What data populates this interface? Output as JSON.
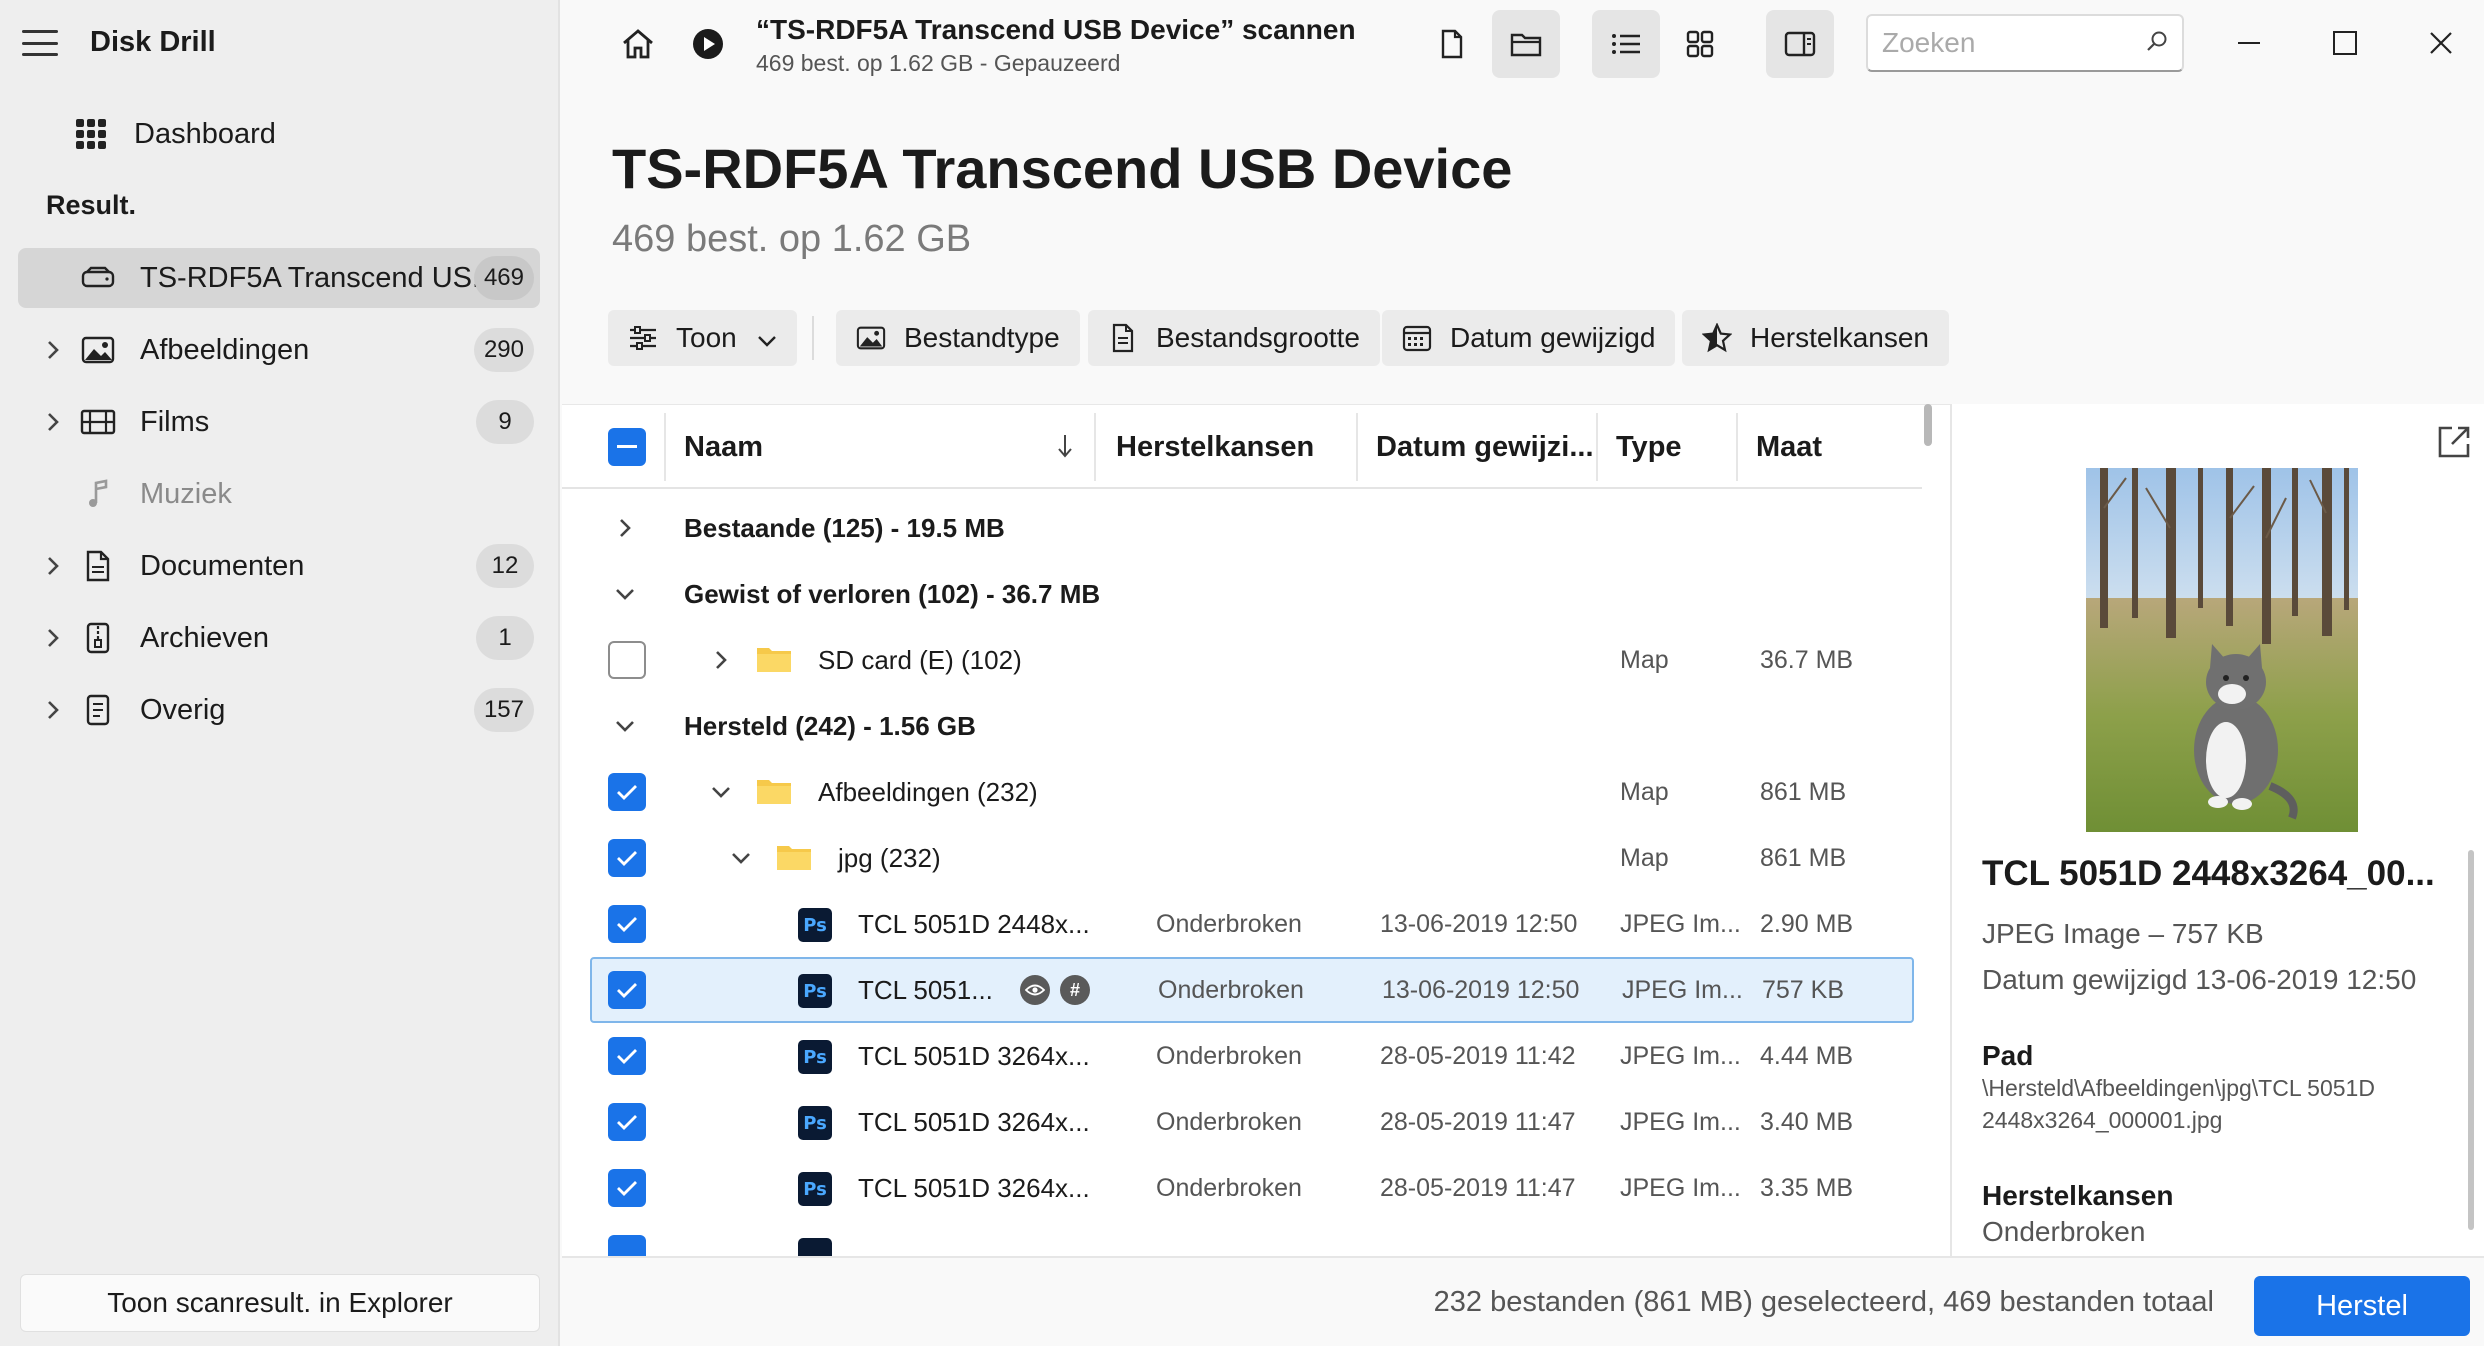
{
  "app": {
    "title": "Disk Drill"
  },
  "sidebar": {
    "dashboard_label": "Dashboard",
    "section_label": "Result.",
    "items": [
      {
        "label": "TS-RDF5A Transcend US...",
        "count": "469",
        "icon": "drive-icon"
      },
      {
        "label": "Afbeeldingen",
        "count": "290",
        "icon": "image-icon"
      },
      {
        "label": "Films",
        "count": "9",
        "icon": "film-icon"
      },
      {
        "label": "Muziek",
        "count": "",
        "icon": "music-note-icon"
      },
      {
        "label": "Documenten",
        "count": "12",
        "icon": "document-icon"
      },
      {
        "label": "Archieven",
        "count": "1",
        "icon": "archive-icon"
      },
      {
        "label": "Overig",
        "count": "157",
        "icon": "other-file-icon"
      }
    ],
    "explorer_button": "Toon scanresult. in Explorer"
  },
  "topbar": {
    "scan_title": "“TS-RDF5A Transcend USB Device” scannen",
    "scan_subtitle": "469 best. op 1.62 GB - Gepauzeerd",
    "search_placeholder": "Zoeken"
  },
  "heading": {
    "title": "TS-RDF5A Transcend USB Device",
    "subtitle": "469 best. op 1.62 GB"
  },
  "filters": {
    "show": "Toon",
    "filetype": "Bestandtype",
    "filesize": "Bestandsgrootte",
    "date_modified": "Datum gewijzigd",
    "recovery_chances": "Herstelkansen"
  },
  "table": {
    "columns": {
      "name": "Naam",
      "chances": "Herstelkansen",
      "date": "Datum gewijzi...",
      "type": "Type",
      "size": "Maat"
    },
    "groups": {
      "existing": "Bestaande (125) - 19.5 MB",
      "deleted": "Gewist of verloren (102) - 36.7 MB",
      "recovered": "Hersteld (242) - 1.56 GB"
    },
    "folders": [
      {
        "name": "SD card (E) (102)",
        "type": "Map",
        "size": "36.7 MB"
      },
      {
        "name": "Afbeeldingen (232)",
        "type": "Map",
        "size": "861 MB"
      },
      {
        "name": "jpg (232)",
        "type": "Map",
        "size": "861 MB"
      }
    ],
    "files": [
      {
        "name": "TCL 5051D 2448x...",
        "chances": "Onderbroken",
        "date": "13-06-2019 12:50",
        "type": "JPEG Im...",
        "size": "2.90 MB"
      },
      {
        "name": "TCL 5051...",
        "chances": "Onderbroken",
        "date": "13-06-2019 12:50",
        "type": "JPEG Im...",
        "size": "757 KB"
      },
      {
        "name": "TCL 5051D 3264x...",
        "chances": "Onderbroken",
        "date": "28-05-2019 11:42",
        "type": "JPEG Im...",
        "size": "4.44 MB"
      },
      {
        "name": "TCL 5051D 3264x...",
        "chances": "Onderbroken",
        "date": "28-05-2019 11:47",
        "type": "JPEG Im...",
        "size": "3.40 MB"
      },
      {
        "name": "TCL 5051D 3264x...",
        "chances": "Onderbroken",
        "date": "28-05-2019 11:47",
        "type": "JPEG Im...",
        "size": "3.35 MB"
      }
    ]
  },
  "preview": {
    "name": "TCL 5051D 2448x3264_00...",
    "type_size": "JPEG Image – 757 KB",
    "date": "Datum gewijzigd 13-06-2019 12:50",
    "path_label": "Pad",
    "path_value": "\\Hersteld\\Afbeeldingen\\jpg\\TCL 5051D 2448x3264_000001.jpg",
    "chances_label": "Herstelkansen",
    "chances_value": "Onderbroken"
  },
  "footer": {
    "status": "232 bestanden (861 MB) geselecteerd, 469 bestanden totaal",
    "recover_button": "Herstel"
  },
  "colors": {
    "accent": "#1a73e8",
    "selected_row": "#e3f0fc",
    "folder": "#f6c94a"
  }
}
